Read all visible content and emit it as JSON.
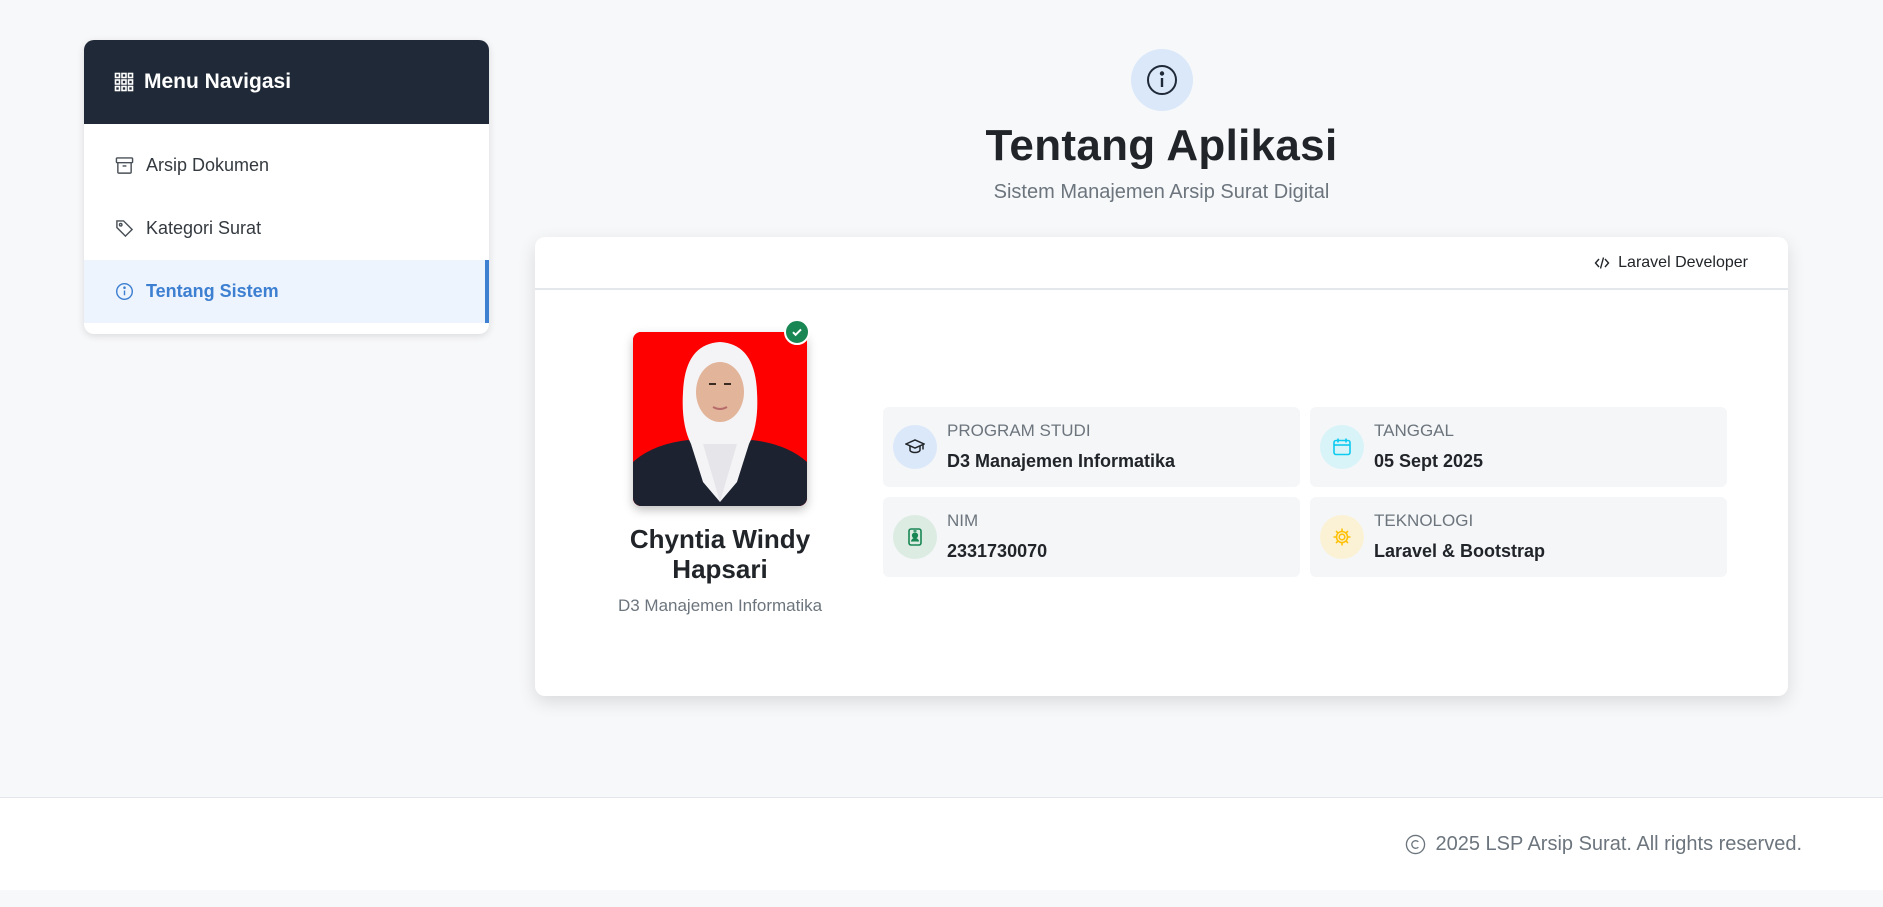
{
  "sidebar": {
    "title": "Menu Navigasi",
    "items": [
      {
        "label": "Arsip Dokumen",
        "icon": "archive-icon"
      },
      {
        "label": "Kategori Surat",
        "icon": "tag-icon"
      },
      {
        "label": "Tentang Sistem",
        "icon": "info-icon",
        "active": true
      }
    ]
  },
  "header": {
    "icon": "info-icon",
    "title": "Tentang Aplikasi",
    "subtitle": "Sistem Manajemen Arsip Surat Digital"
  },
  "card": {
    "badge": "Laravel Developer",
    "profile": {
      "name": "Chyntia Windy Hapsari",
      "role": "D3 Manajemen Informatika",
      "verified": true
    },
    "info": [
      {
        "label": "PROGRAM STUDI",
        "value": "D3 Manajemen Informatika",
        "icon": "graduation-cap-icon",
        "color": "#212529",
        "bg": "#dbe8f9"
      },
      {
        "label": "TANGGAL",
        "value": "05 Sept 2025",
        "icon": "calendar-icon",
        "color": "#0dcaf0",
        "bg": "#d9f4f8"
      },
      {
        "label": "NIM",
        "value": "2331730070",
        "icon": "id-badge-icon",
        "color": "#198754",
        "bg": "#dcece3"
      },
      {
        "label": "TEKNOLOGI",
        "value": "Laravel & Bootstrap",
        "icon": "gear-icon",
        "color": "#ffc107",
        "bg": "#fbf2d6"
      }
    ]
  },
  "footer": {
    "text": "2025 LSP Arsip Surat. All rights reserved."
  },
  "colors": {
    "sidebar_header": "#1f2937",
    "accent": "#3d7fd1",
    "success": "#198754"
  }
}
